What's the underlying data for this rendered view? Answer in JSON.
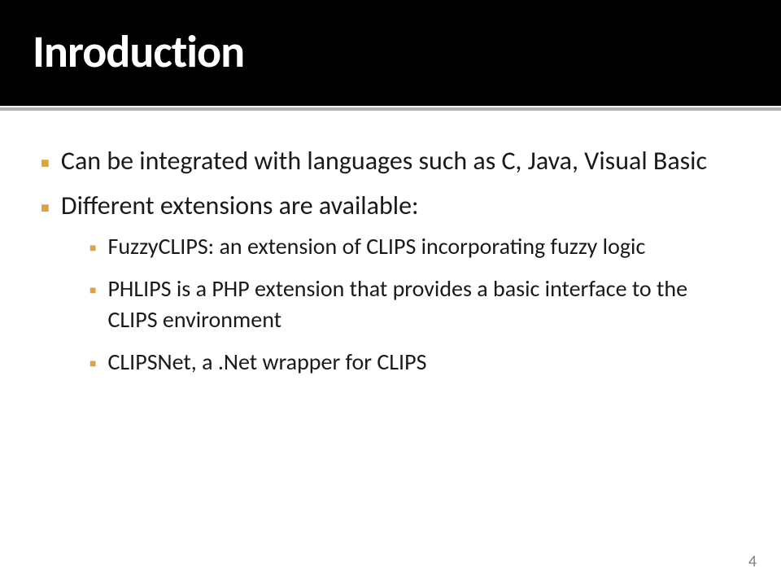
{
  "title": "Inroduction",
  "bullets": {
    "item0": "Can be integrated with languages such as C, Java, Visual Basic",
    "item1": "Different extensions are available:",
    "sub0": "FuzzyCLIPS: an extension of CLIPS incorporating fuzzy logic",
    "sub1": "PHLIPS is a PHP extension that provides a basic interface to the CLIPS environment",
    "sub2": "CLIPSNet, a .Net wrapper for CLIPS"
  },
  "page_number": "4"
}
